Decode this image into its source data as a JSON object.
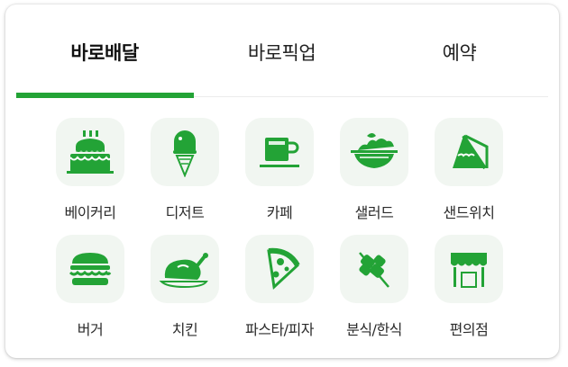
{
  "tabs": [
    {
      "label": "바로배달",
      "active": true
    },
    {
      "label": "바로픽업",
      "active": false
    },
    {
      "label": "예약",
      "active": false
    }
  ],
  "accent_color": "#23a336",
  "categories": [
    {
      "label": "베이커리",
      "icon": "cake-icon"
    },
    {
      "label": "디저트",
      "icon": "ice-cream-icon"
    },
    {
      "label": "카페",
      "icon": "coffee-cup-icon"
    },
    {
      "label": "샐러드",
      "icon": "salad-bowl-icon"
    },
    {
      "label": "샌드위치",
      "icon": "sandwich-icon"
    },
    {
      "label": "버거",
      "icon": "burger-icon"
    },
    {
      "label": "치킨",
      "icon": "roast-chicken-icon"
    },
    {
      "label": "파스타/피자",
      "icon": "pizza-slice-icon"
    },
    {
      "label": "분식/한식",
      "icon": "skewer-icon"
    },
    {
      "label": "편의점",
      "icon": "store-awning-icon"
    }
  ]
}
